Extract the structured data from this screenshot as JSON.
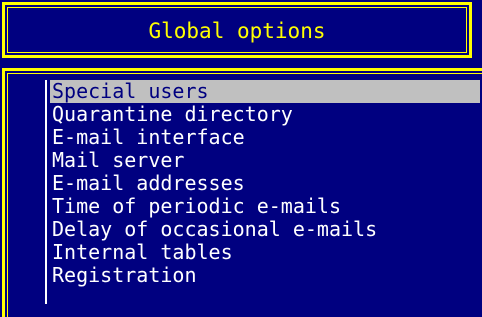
{
  "title": "Global options",
  "menu": {
    "items": [
      {
        "label": "Special users",
        "selected": true
      },
      {
        "label": "Quarantine directory",
        "selected": false
      },
      {
        "label": "E-mail interface",
        "selected": false
      },
      {
        "label": "Mail server",
        "selected": false
      },
      {
        "label": "E-mail addresses",
        "selected": false
      },
      {
        "label": "Time of periodic e-mails",
        "selected": false
      },
      {
        "label": "Delay of occasional e-mails",
        "selected": false
      },
      {
        "label": "Internal tables",
        "selected": false
      },
      {
        "label": "Registration",
        "selected": false
      }
    ]
  },
  "colors": {
    "background": "#000080",
    "border": "#ffff00",
    "title_text": "#ffff00",
    "item_text": "#ffffff",
    "selection_background": "#c0c0c0",
    "selection_text": "#000080"
  }
}
